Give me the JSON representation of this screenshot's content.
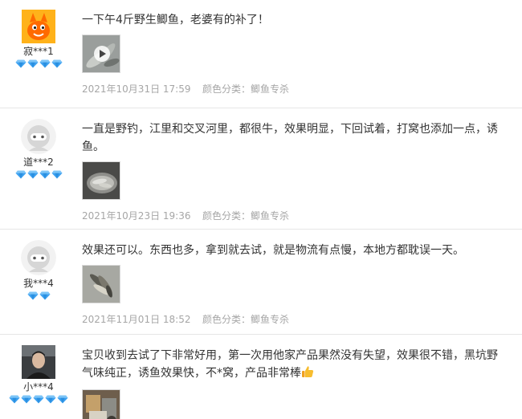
{
  "reviews": [
    {
      "nick": "寂***1",
      "gem_count": 4,
      "text": "一下午4斤野生鲫鱼，老婆有的补了！",
      "date": "2021年10月31日 17:59",
      "sku": "颜色分类：鲫鱼专杀"
    },
    {
      "nick": "道***2",
      "gem_count": 4,
      "text_line1": "一直是野钓，江里和交叉河里，都很牛，效果明显，下回试着，打窝也添加一点，诱",
      "text_line2": "鱼。",
      "date": "2021年10月23日 19:36",
      "sku": "颜色分类：鲫鱼专杀"
    },
    {
      "nick": "我***4",
      "gem_count": 2,
      "text": "效果还可以。东西也多，拿到就去试，就是物流有点慢，本地方都耽误一天。",
      "date": "2021年11月01日 18:52",
      "sku": "颜色分类：鲫鱼专杀"
    },
    {
      "nick": "小***4",
      "gem_count": 5,
      "text_line1": "宝贝收到去试了下非常好用，第一次用他家产品果然没有失望，效果很不错，黑坑野",
      "text_line2": "气味纯正，诱鱼效果快，不*窝，产品非常棒"
    }
  ],
  "icons": {
    "gem": "diamond-icon",
    "play": "play-icon",
    "thumbs_up": "thumbs-up-emoji"
  },
  "colors": {
    "text": "#333333",
    "meta": "#a6a6a6",
    "gem": "#3ba0f0",
    "divider": "#e6e6e6"
  }
}
